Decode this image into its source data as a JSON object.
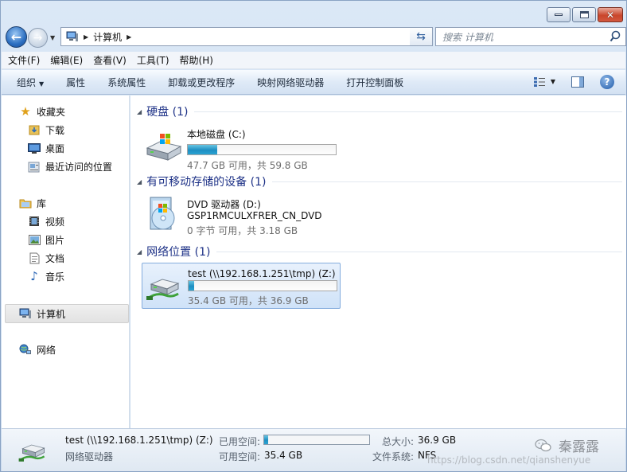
{
  "window": {
    "breadcrumb": [
      "计算机"
    ],
    "search_placeholder": "搜索 计算机"
  },
  "menu": [
    "文件(F)",
    "编辑(E)",
    "查看(V)",
    "工具(T)",
    "帮助(H)"
  ],
  "toolbar": {
    "organize": "组织",
    "properties": "属性",
    "system_properties": "系统属性",
    "uninstall": "卸载或更改程序",
    "map_drive": "映射网络驱动器",
    "control_panel": "打开控制面板"
  },
  "nav": {
    "favorites": "收藏夹",
    "downloads": "下载",
    "desktop": "桌面",
    "recent": "最近访问的位置",
    "libraries": "库",
    "videos": "视频",
    "pictures": "图片",
    "documents": "文档",
    "music": "音乐",
    "computer": "计算机",
    "network": "网络"
  },
  "groups": [
    {
      "title": "硬盘 (1)",
      "items": [
        {
          "name": "本地磁盘 (C:)",
          "info": "47.7 GB 可用，共 59.8 GB",
          "used_fraction": 0.2
        }
      ]
    },
    {
      "title": "有可移动存储的设备 (1)",
      "items": [
        {
          "name": "DVD 驱动器 (D:)",
          "label": "GSP1RMCULXFRER_CN_DVD",
          "info": "0 字节 可用，共 3.18 GB"
        }
      ]
    },
    {
      "title": "网络位置 (1)",
      "items": [
        {
          "name": "test (\\\\192.168.1.251\\tmp) (Z:)",
          "info": "35.4 GB 可用，共 36.9 GB",
          "used_fraction": 0.04
        }
      ]
    }
  ],
  "details": {
    "name": "test (\\\\192.168.1.251\\tmp) (Z:)",
    "type": "网络驱动器",
    "used_label": "已用空间:",
    "used_fraction": 0.04,
    "free_label": "可用空间:",
    "free_value": "35.4 GB",
    "total_label": "总大小:",
    "total_value": "36.9 GB",
    "fs_label": "文件系统:",
    "fs_value": "NFS"
  },
  "watermark": {
    "url": "https://blog.csdn.net/qianshenyue",
    "author": "秦露露"
  },
  "colors": {
    "group_title": "#1e3287",
    "bar_fill": "#1e8fc2",
    "selection": "#cfe2f8"
  }
}
